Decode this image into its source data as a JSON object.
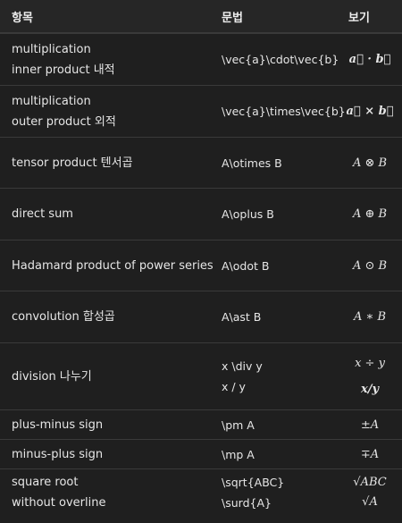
{
  "header": {
    "col1": "항목",
    "col2": "문법",
    "col3": "보기"
  },
  "rows": [
    {
      "name": [
        "multiplication",
        "inner product 내적"
      ],
      "syntax": [
        "\\vec{a}\\cdot\\vec{b}"
      ],
      "view": [
        "a⃗ · b⃗"
      ]
    },
    {
      "name": [
        "multiplication",
        "outer product 외적"
      ],
      "syntax": [
        "\\vec{a}\\times\\vec{b}"
      ],
      "view": [
        "a⃗ × b⃗"
      ]
    },
    {
      "name": [
        "tensor product 텐서곱"
      ],
      "syntax": [
        "A\\otimes B"
      ],
      "view": [
        "A ⊗ B"
      ]
    },
    {
      "name": [
        "direct sum"
      ],
      "syntax": [
        "A\\oplus B"
      ],
      "view": [
        "A ⊕ B"
      ]
    },
    {
      "name": [
        "Hadamard product of power series"
      ],
      "syntax": [
        "A\\odot B"
      ],
      "view": [
        "A ⊙ B"
      ]
    },
    {
      "name": [
        "convolution 합성곱"
      ],
      "syntax": [
        "A\\ast B"
      ],
      "view": [
        "A ∗ B"
      ]
    },
    {
      "name": [
        "division 나누기"
      ],
      "syntax": [
        "x \\div y",
        "x / y"
      ],
      "view": [
        "x ÷ y",
        "x/y"
      ]
    },
    {
      "name": [
        "plus-minus sign"
      ],
      "syntax": [
        "\\pm A"
      ],
      "view": [
        "±A"
      ]
    },
    {
      "name": [
        "minus-plus sign"
      ],
      "syntax": [
        "\\mp A"
      ],
      "view": [
        "∓A"
      ]
    },
    {
      "name": [
        "square root",
        "without overline"
      ],
      "syntax": [
        "\\sqrt{ABC}",
        "\\surd{A}"
      ],
      "view": [
        "√ABC",
        "√A"
      ]
    }
  ]
}
